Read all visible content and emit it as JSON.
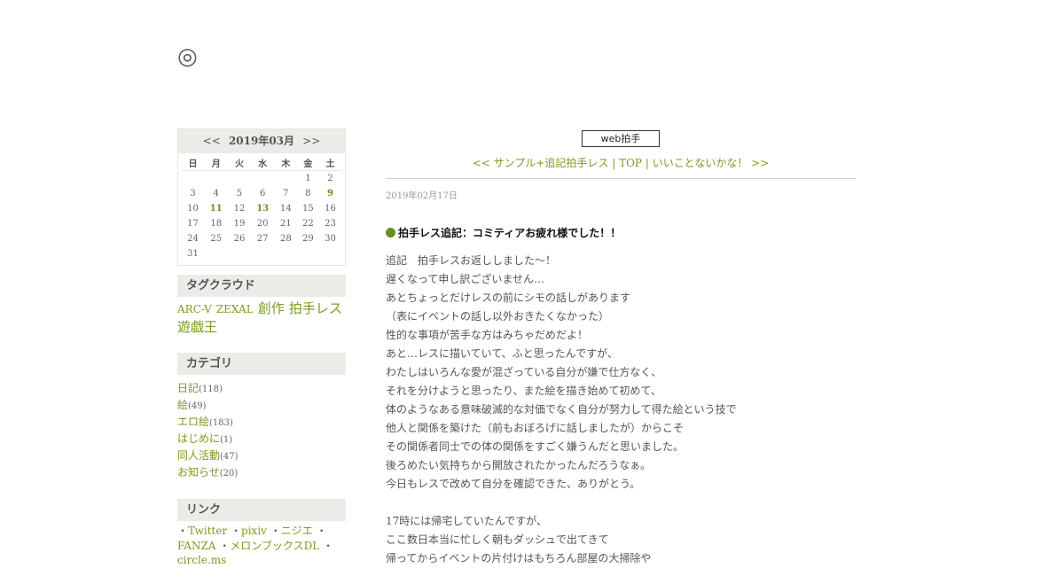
{
  "site": {
    "title": "◎"
  },
  "calendar": {
    "prev": "<<",
    "next": ">>",
    "month_label": "2019年03月",
    "weekdays": [
      "日",
      "月",
      "火",
      "水",
      "木",
      "金",
      "土"
    ],
    "weeks": [
      [
        "",
        "",
        "",
        "",
        "",
        "1",
        "2"
      ],
      [
        "3",
        "4",
        "5",
        "6",
        "7",
        "8",
        "9"
      ],
      [
        "10",
        "11",
        "12",
        "13",
        "14",
        "15",
        "16"
      ],
      [
        "17",
        "18",
        "19",
        "20",
        "21",
        "22",
        "23"
      ],
      [
        "24",
        "25",
        "26",
        "27",
        "28",
        "29",
        "30"
      ],
      [
        "31",
        "",
        "",
        "",
        "",
        "",
        ""
      ]
    ],
    "linked_days": [
      "9",
      "11",
      "13"
    ]
  },
  "tagcloud": {
    "title": "タグクラウド",
    "tags": [
      {
        "label": "ARC-V",
        "size": "s"
      },
      {
        "label": "ZEXAL",
        "size": "s"
      },
      {
        "label": "創作",
        "size": "l"
      },
      {
        "label": "拍手レス",
        "size": "l"
      },
      {
        "label": "遊戯王",
        "size": "l"
      }
    ]
  },
  "categories": {
    "title": "カテゴリ",
    "items": [
      {
        "label": "日記",
        "count": "(118)"
      },
      {
        "label": "絵",
        "count": "(49)"
      },
      {
        "label": "エロ絵",
        "count": "(183)"
      },
      {
        "label": "はじめに",
        "count": "(1)"
      },
      {
        "label": "同人活動",
        "count": "(47)"
      },
      {
        "label": "お知らせ",
        "count": "(20)"
      }
    ]
  },
  "links": {
    "title": "リンク",
    "items": [
      "Twitter",
      "pixiv",
      "ニジエ",
      "FANZA",
      "メロンブックスDL",
      "circle.ms"
    ]
  },
  "main": {
    "clap_button": "web拍手",
    "nav": {
      "prev": "<< サンプル+追記拍手レス",
      "sep": "|",
      "top": "TOP",
      "next": "いいことないかな！ >>"
    },
    "date": "2019年02月17日",
    "entry_title": "拍手レス追記：コミティアお疲れ様でした！！",
    "body_lines": [
      "追記　拍手レスお返ししました～！",
      "遅くなって申し訳ございません…",
      "あとちょっとだけレスの前にシモの話しがあります",
      "（表にイベントの話し以外おきたくなかった）",
      "性的な事項が苦手な方はみちゃだめだよ！",
      "あと…レスに描いていて、ふと思ったんですが、",
      "わたしはいろんな愛が混ざっている自分が嫌で仕方なく、",
      "それを分けようと思ったり、また絵を描き始めて初めて、",
      "体のようなある意味破滅的な対価でなく自分が努力して得た絵という技で",
      "他人と関係を築けた（前もおぼろげに話しましたが）からこそ",
      "その関係者同士での体の関係をすごく嫌うんだと思いました。",
      "後ろめたい気持ちから開放されたかったんだろうなぁ。",
      "今日もレスで改めて自分を確認できた、ありがとう。",
      "",
      "17時には帰宅していたんですが、",
      "ここ数日本当に忙しく朝もダッシュで出てきて",
      "帰ってからイベントの片付けはもちろん部屋の大掃除や"
    ]
  }
}
